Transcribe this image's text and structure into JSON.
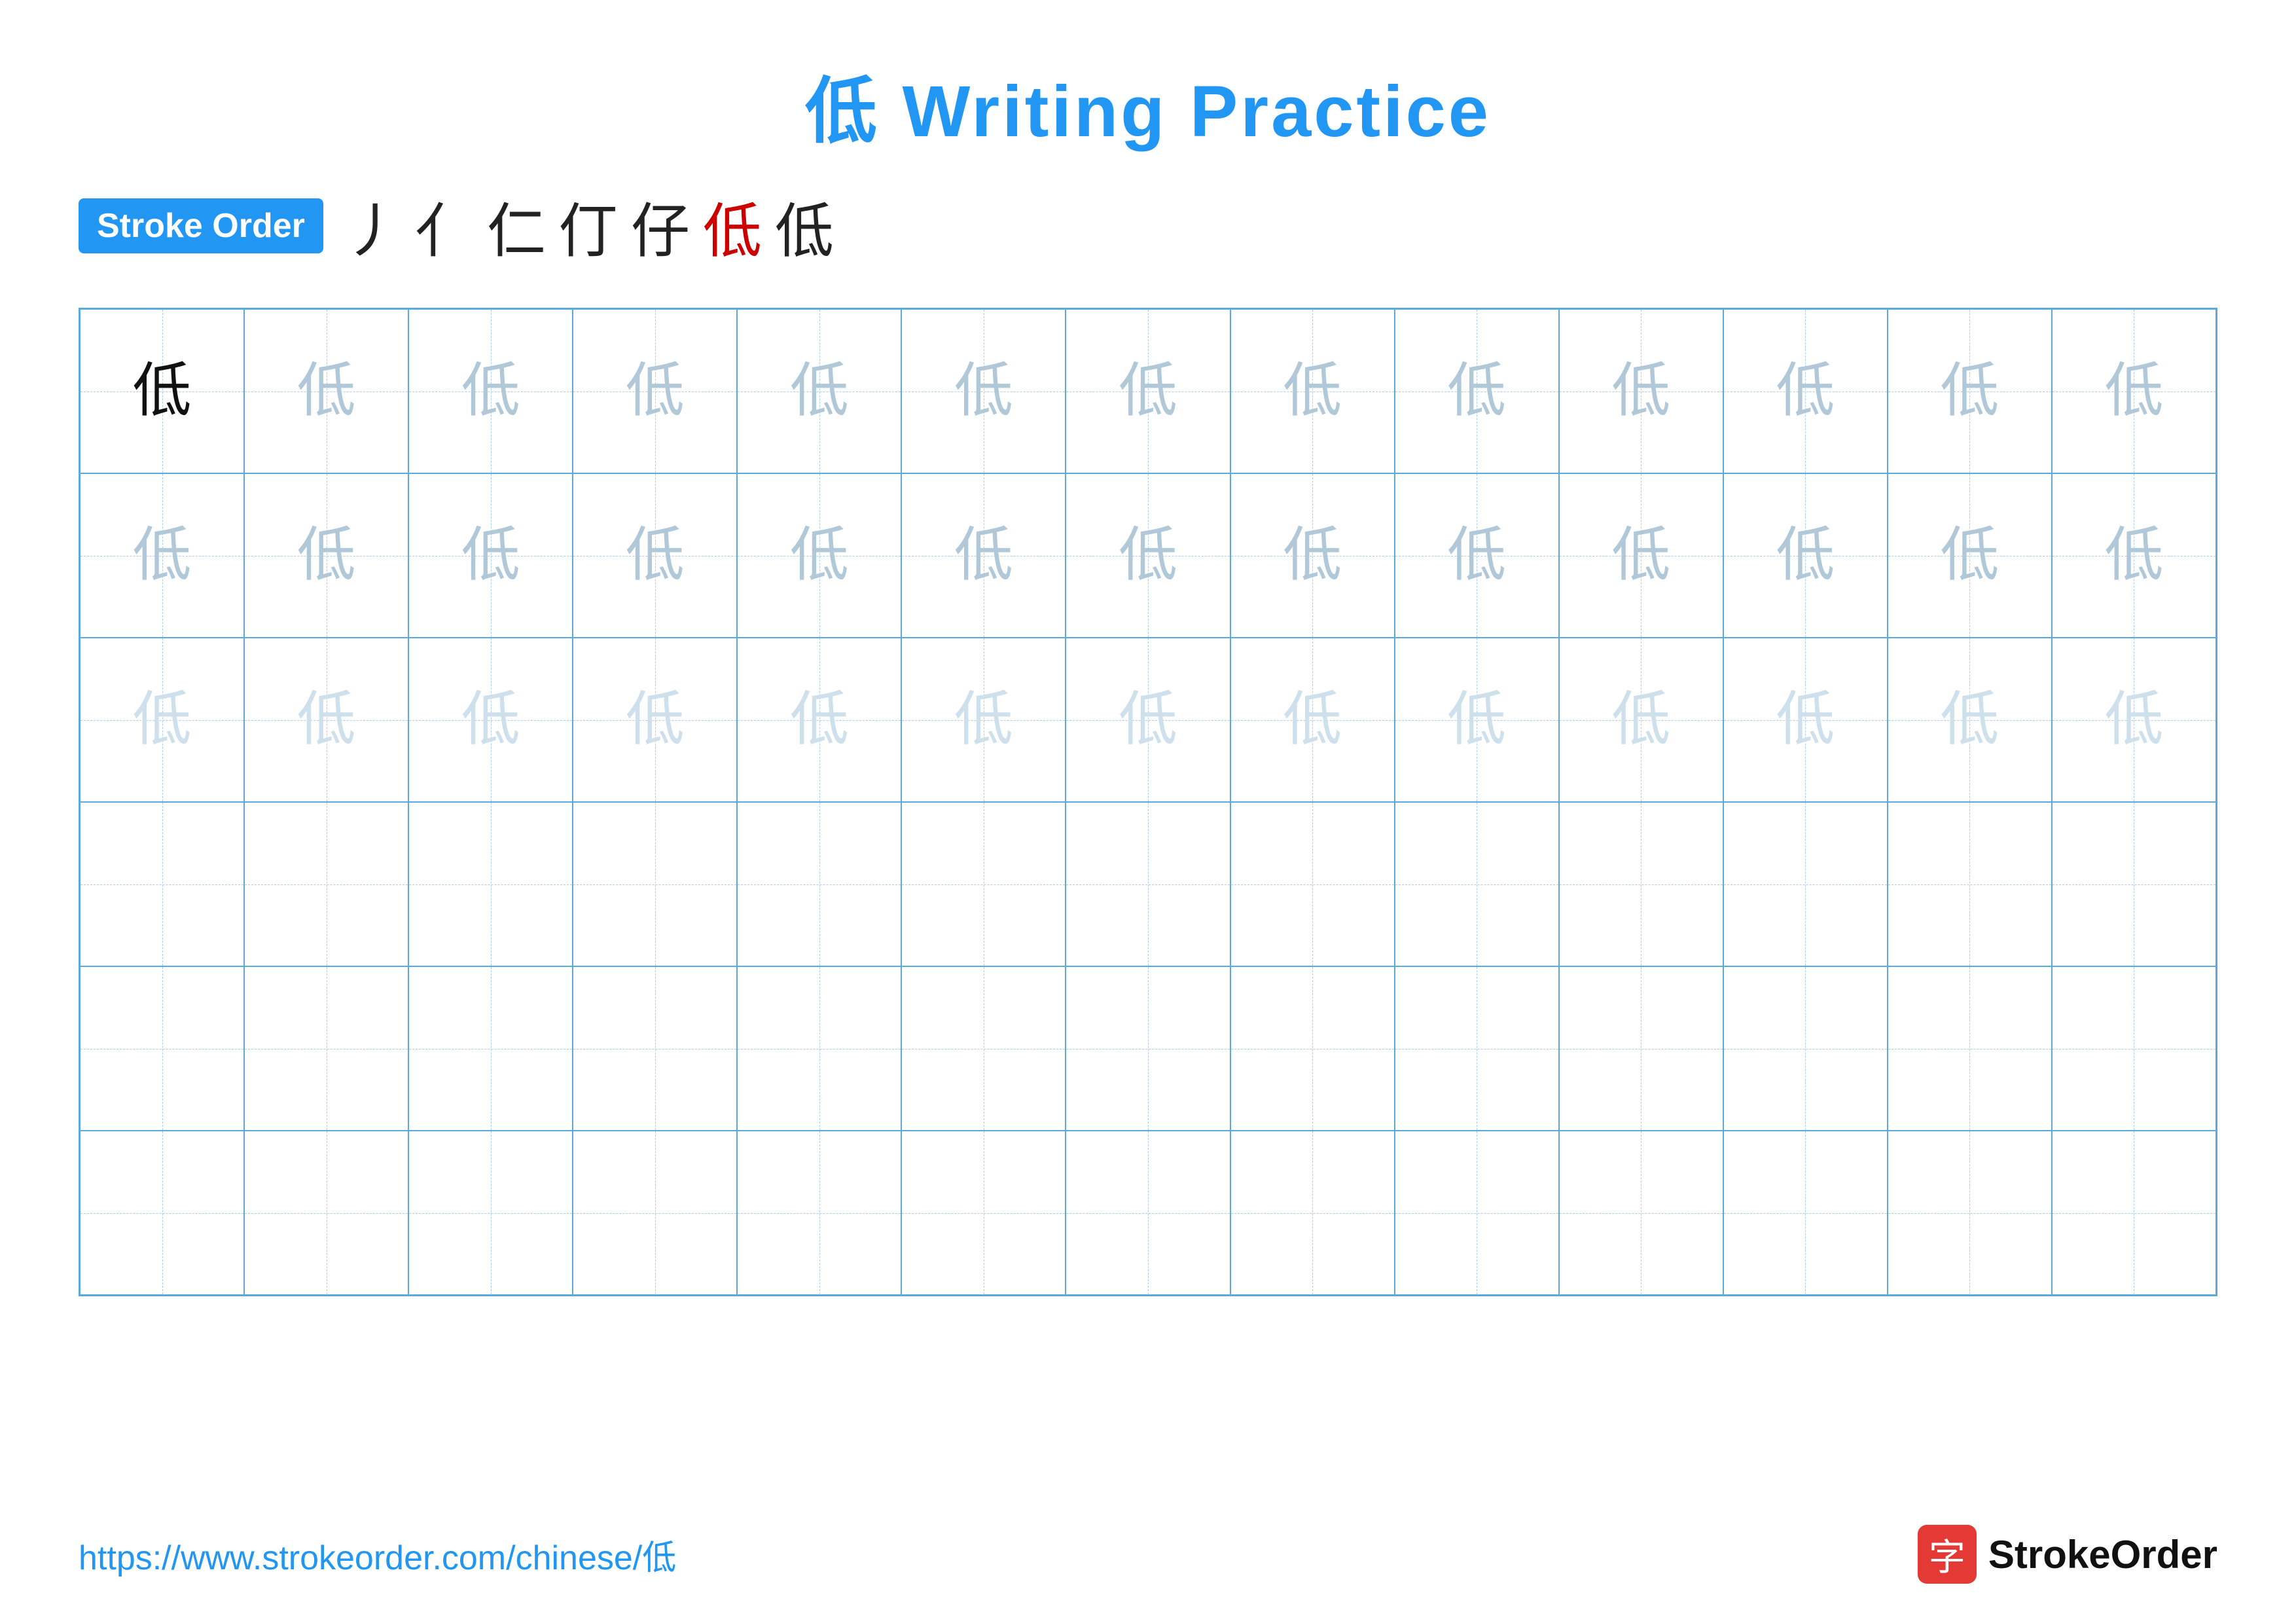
{
  "title": "低 Writing Practice",
  "stroke_order_label": "Stroke Order",
  "stroke_sequence": [
    "丿",
    "亻",
    "仁",
    "仃",
    "仔",
    "低",
    "低"
  ],
  "stroke_sequence_colors": [
    "dark",
    "dark",
    "dark",
    "dark",
    "dark",
    "red",
    "dark"
  ],
  "character": "低",
  "rows": [
    {
      "cells": [
        {
          "char": "低",
          "style": "dark"
        },
        {
          "char": "低",
          "style": "mid-gray"
        },
        {
          "char": "低",
          "style": "mid-gray"
        },
        {
          "char": "低",
          "style": "mid-gray"
        },
        {
          "char": "低",
          "style": "mid-gray"
        },
        {
          "char": "低",
          "style": "mid-gray"
        },
        {
          "char": "低",
          "style": "mid-gray"
        },
        {
          "char": "低",
          "style": "mid-gray"
        },
        {
          "char": "低",
          "style": "mid-gray"
        },
        {
          "char": "低",
          "style": "mid-gray"
        },
        {
          "char": "低",
          "style": "mid-gray"
        },
        {
          "char": "低",
          "style": "mid-gray"
        },
        {
          "char": "低",
          "style": "mid-gray"
        }
      ]
    },
    {
      "cells": [
        {
          "char": "低",
          "style": "mid-gray"
        },
        {
          "char": "低",
          "style": "mid-gray"
        },
        {
          "char": "低",
          "style": "mid-gray"
        },
        {
          "char": "低",
          "style": "mid-gray"
        },
        {
          "char": "低",
          "style": "mid-gray"
        },
        {
          "char": "低",
          "style": "mid-gray"
        },
        {
          "char": "低",
          "style": "mid-gray"
        },
        {
          "char": "低",
          "style": "mid-gray"
        },
        {
          "char": "低",
          "style": "mid-gray"
        },
        {
          "char": "低",
          "style": "mid-gray"
        },
        {
          "char": "低",
          "style": "mid-gray"
        },
        {
          "char": "低",
          "style": "mid-gray"
        },
        {
          "char": "低",
          "style": "mid-gray"
        }
      ]
    },
    {
      "cells": [
        {
          "char": "低",
          "style": "light-gray"
        },
        {
          "char": "低",
          "style": "light-gray"
        },
        {
          "char": "低",
          "style": "light-gray"
        },
        {
          "char": "低",
          "style": "light-gray"
        },
        {
          "char": "低",
          "style": "light-gray"
        },
        {
          "char": "低",
          "style": "light-gray"
        },
        {
          "char": "低",
          "style": "light-gray"
        },
        {
          "char": "低",
          "style": "light-gray"
        },
        {
          "char": "低",
          "style": "light-gray"
        },
        {
          "char": "低",
          "style": "light-gray"
        },
        {
          "char": "低",
          "style": "light-gray"
        },
        {
          "char": "低",
          "style": "light-gray"
        },
        {
          "char": "低",
          "style": "light-gray"
        }
      ]
    },
    {
      "cells": [
        {
          "char": "",
          "style": "empty"
        },
        {
          "char": "",
          "style": "empty"
        },
        {
          "char": "",
          "style": "empty"
        },
        {
          "char": "",
          "style": "empty"
        },
        {
          "char": "",
          "style": "empty"
        },
        {
          "char": "",
          "style": "empty"
        },
        {
          "char": "",
          "style": "empty"
        },
        {
          "char": "",
          "style": "empty"
        },
        {
          "char": "",
          "style": "empty"
        },
        {
          "char": "",
          "style": "empty"
        },
        {
          "char": "",
          "style": "empty"
        },
        {
          "char": "",
          "style": "empty"
        },
        {
          "char": "",
          "style": "empty"
        }
      ]
    },
    {
      "cells": [
        {
          "char": "",
          "style": "empty"
        },
        {
          "char": "",
          "style": "empty"
        },
        {
          "char": "",
          "style": "empty"
        },
        {
          "char": "",
          "style": "empty"
        },
        {
          "char": "",
          "style": "empty"
        },
        {
          "char": "",
          "style": "empty"
        },
        {
          "char": "",
          "style": "empty"
        },
        {
          "char": "",
          "style": "empty"
        },
        {
          "char": "",
          "style": "empty"
        },
        {
          "char": "",
          "style": "empty"
        },
        {
          "char": "",
          "style": "empty"
        },
        {
          "char": "",
          "style": "empty"
        },
        {
          "char": "",
          "style": "empty"
        }
      ]
    },
    {
      "cells": [
        {
          "char": "",
          "style": "empty"
        },
        {
          "char": "",
          "style": "empty"
        },
        {
          "char": "",
          "style": "empty"
        },
        {
          "char": "",
          "style": "empty"
        },
        {
          "char": "",
          "style": "empty"
        },
        {
          "char": "",
          "style": "empty"
        },
        {
          "char": "",
          "style": "empty"
        },
        {
          "char": "",
          "style": "empty"
        },
        {
          "char": "",
          "style": "empty"
        },
        {
          "char": "",
          "style": "empty"
        },
        {
          "char": "",
          "style": "empty"
        },
        {
          "char": "",
          "style": "empty"
        },
        {
          "char": "",
          "style": "empty"
        }
      ]
    }
  ],
  "footer": {
    "url": "https://www.strokeorder.com/chinese/低",
    "brand_char": "字",
    "brand_name": "StrokeOrder"
  }
}
